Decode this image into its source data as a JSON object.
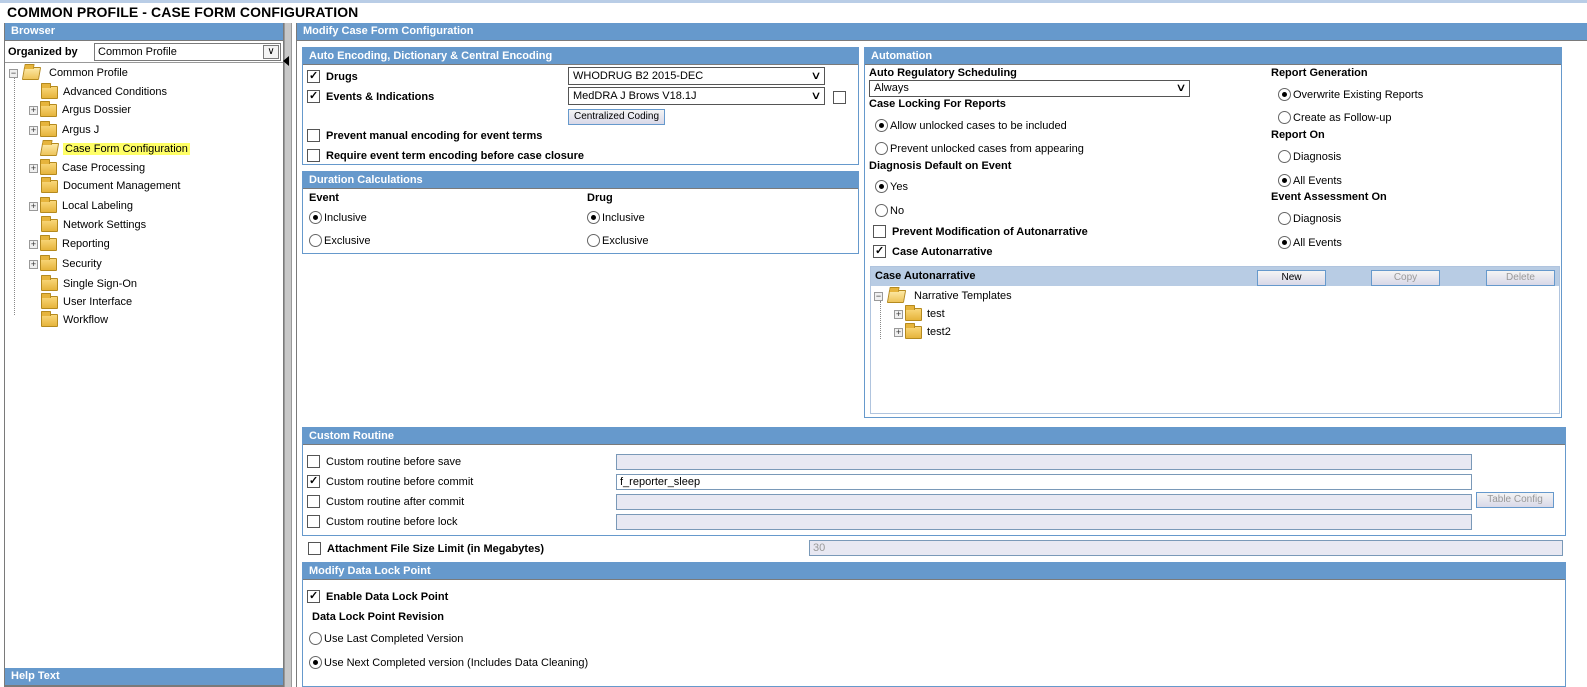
{
  "page_title": "COMMON PROFILE - CASE FORM CONFIGURATION",
  "browser": {
    "header": "Browser",
    "organized_by_label": "Organized by",
    "organized_by_value": "Common Profile",
    "tree": {
      "root": "Common Profile",
      "items": [
        {
          "label": "Advanced Conditions",
          "expandable": false,
          "selected": false
        },
        {
          "label": "Argus Dossier",
          "expandable": true,
          "selected": false
        },
        {
          "label": "Argus J",
          "expandable": true,
          "selected": false
        },
        {
          "label": "Case Form Configuration",
          "expandable": false,
          "selected": true
        },
        {
          "label": "Case Processing",
          "expandable": true,
          "selected": false
        },
        {
          "label": "Document Management",
          "expandable": false,
          "selected": false
        },
        {
          "label": "Local Labeling",
          "expandable": true,
          "selected": false
        },
        {
          "label": "Network Settings",
          "expandable": false,
          "selected": false
        },
        {
          "label": "Reporting",
          "expandable": true,
          "selected": false
        },
        {
          "label": "Security",
          "expandable": true,
          "selected": false
        },
        {
          "label": "Single Sign-On",
          "expandable": false,
          "selected": false
        },
        {
          "label": "User Interface",
          "expandable": false,
          "selected": false
        },
        {
          "label": "Workflow",
          "expandable": false,
          "selected": false
        }
      ]
    },
    "help_text_header": "Help Text"
  },
  "main": {
    "header": "Modify Case Form Configuration",
    "auto_encoding": {
      "header": "Auto Encoding, Dictionary & Central Encoding",
      "drugs_label": "Drugs",
      "drugs_checked": true,
      "drugs_dictionary": "WHODRUG B2 2015-DEC",
      "events_label": "Events & Indications",
      "events_checked": true,
      "events_dictionary": "MedDRA J Brows V18.1J",
      "events_extra_checked": false,
      "centralized_coding_button": "Centralized Coding",
      "prevent_manual_label": "Prevent manual encoding for event terms",
      "prevent_manual_checked": false,
      "require_encoding_label": "Require event term encoding before case closure",
      "require_encoding_checked": false
    },
    "duration": {
      "header": "Duration Calculations",
      "event_label": "Event",
      "drug_label": "Drug",
      "inclusive": "Inclusive",
      "exclusive": "Exclusive",
      "event_value": "Inclusive",
      "drug_value": "Inclusive"
    },
    "automation": {
      "header": "Automation",
      "auto_reg_label": "Auto Regulatory Scheduling",
      "auto_reg_value": "Always",
      "case_locking_label": "Case Locking For Reports",
      "allow_unlocked": "Allow unlocked cases to be included",
      "prevent_unlocked": "Prevent unlocked cases from appearing",
      "case_locking_value": "allow",
      "diagnosis_default_label": "Diagnosis Default on Event",
      "yes": "Yes",
      "no": "No",
      "diagnosis_default_value": "Yes",
      "prevent_modification_label": "Prevent Modification of Autonarrative",
      "prevent_modification_checked": false,
      "case_autonarrative_label": "Case Autonarrative",
      "case_autonarrative_checked": true,
      "report_generation_label": "Report Generation",
      "overwrite": "Overwrite Existing Reports",
      "follow_up": "Create as Follow-up",
      "report_generation_value": "overwrite",
      "report_on_label": "Report On",
      "diagnosis": "Diagnosis",
      "all_events": "All Events",
      "report_on_value": "All Events",
      "event_assessment_label": "Event Assessment On",
      "event_assessment_value": "All Events",
      "autonarrative_panel": {
        "header": "Case Autonarrative",
        "new_button": "New",
        "copy_button": "Copy",
        "delete_button": "Delete",
        "root": "Narrative Templates",
        "templates": [
          "test",
          "test2"
        ]
      }
    },
    "custom_routine": {
      "header": "Custom Routine",
      "rows": [
        {
          "label": "Custom routine before save",
          "checked": false,
          "value": ""
        },
        {
          "label": "Custom routine before commit",
          "checked": true,
          "value": "f_reporter_sleep"
        },
        {
          "label": "Custom routine after commit",
          "checked": false,
          "value": ""
        },
        {
          "label": "Custom routine before lock",
          "checked": false,
          "value": ""
        }
      ],
      "table_config_button": "Table Config"
    },
    "attachment": {
      "label": "Attachment File Size Limit (in Megabytes)",
      "checked": false,
      "value": "30"
    },
    "data_lock": {
      "header": "Modify Data Lock Point",
      "enable_label": "Enable Data Lock Point",
      "enable_checked": true,
      "revision_label": "Data Lock Point Revision",
      "use_last": "Use Last Completed Version",
      "use_next": "Use Next Completed version (Includes Data Cleaning)",
      "revision_value": "next"
    }
  }
}
